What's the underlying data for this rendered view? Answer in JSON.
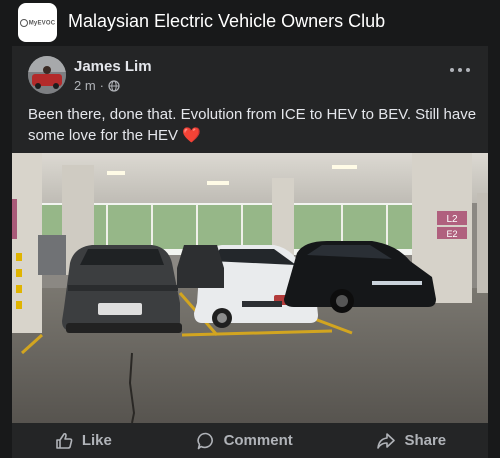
{
  "group": {
    "logo_text": "MyEVOC",
    "name": "Malaysian Electric Vehicle Owners Club"
  },
  "post": {
    "author": "James Lim",
    "time": "2 m",
    "privacy_icon": "globe-icon",
    "text": "Been there, done that. Evolution from ICE to HEV to BEV. Still have some love for the HEV",
    "emoji": "❤️",
    "photo": {
      "pillar_sign_top": "L2",
      "pillar_sign_bottom": "E2"
    }
  },
  "actions": {
    "like": "Like",
    "comment": "Comment",
    "share": "Share"
  },
  "colors": {
    "background": "#18191a",
    "card": "#242526",
    "text_primary": "#e4e6eb",
    "text_secondary": "#b0b3b8",
    "heart": "#f33e58"
  }
}
